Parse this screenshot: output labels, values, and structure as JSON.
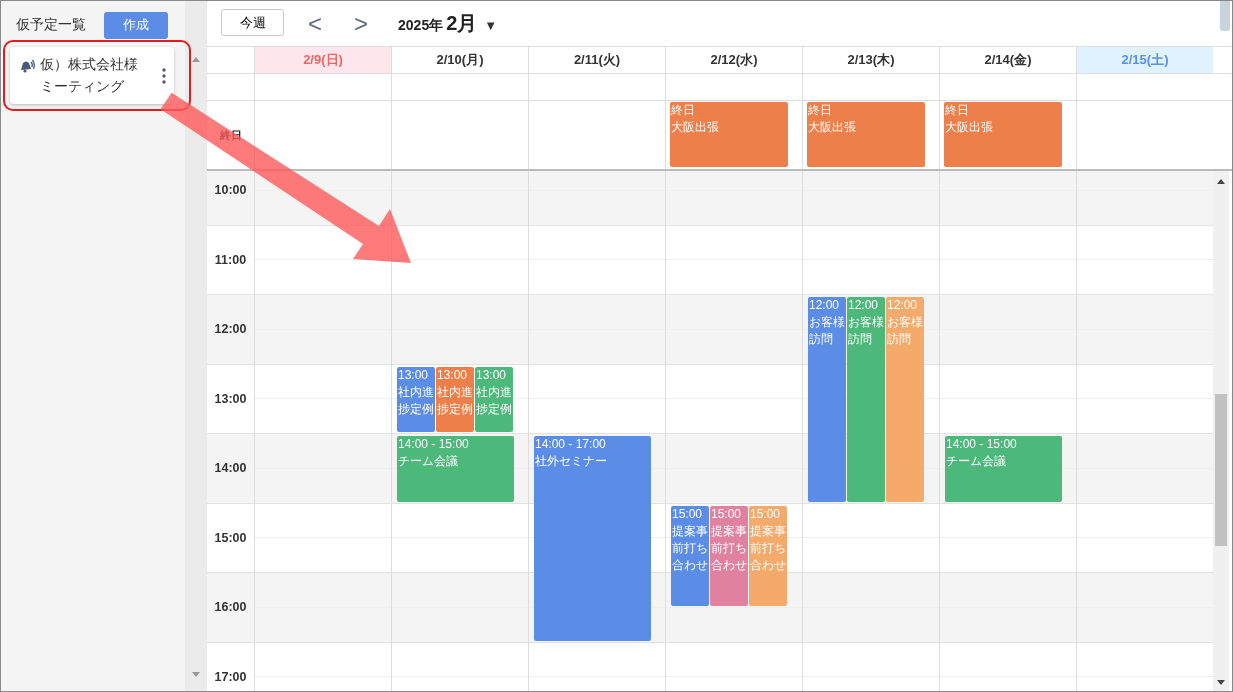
{
  "sidebar": {
    "title": "仮予定一覧",
    "create_button": "作成",
    "items": [
      {
        "title": "仮）株式会社様ミーティング"
      }
    ]
  },
  "toolbar": {
    "this_week": "今週",
    "prev": "<",
    "next": ">",
    "year": "2025年",
    "month": "2月",
    "dropdown": "▼"
  },
  "allday_label": "終日",
  "times": [
    "10:00",
    "11:00",
    "12:00",
    "13:00",
    "14:00",
    "15:00",
    "16:00",
    "17:00"
  ],
  "days": [
    {
      "date": "2/9(日)",
      "kind": "sunday"
    },
    {
      "date": "2/10(月)",
      "kind": "weekday",
      "slots": [
        {
          "kind": "hour",
          "events": [
            {
              "time": "13:00",
              "title": "社内進捗定例",
              "color": "#5b8de6"
            },
            {
              "time": "13:00",
              "title": "社内進捗定例",
              "color": "#ec7f4a"
            },
            {
              "time": "13:00",
              "title": "社内進捗定例",
              "color": "#4cb87a"
            }
          ]
        },
        {
          "kind": "hour",
          "events": [
            {
              "time": "14:00 - 15:00",
              "title": "チーム会議",
              "color": "#4cb87a"
            }
          ]
        }
      ]
    },
    {
      "date": "2/11(火)",
      "kind": "weekday",
      "slots": [
        {
          "kind": "threehour",
          "events": [
            {
              "time": "14:00 - 17:00",
              "title": "社外セミナー",
              "color": "#5b8de6"
            }
          ]
        }
      ]
    },
    {
      "date": "2/12(水)",
      "kind": "weekday",
      "allday": [
        {
          "time": "終日",
          "title": "大阪出張",
          "color": "#ec7f4a"
        }
      ],
      "slots": [
        {
          "kind": "ninety",
          "events": [
            {
              "time": "15:00",
              "title": "提案事前打ち合わせ",
              "color": "#5b8de6"
            },
            {
              "time": "15:00",
              "title": "提案事前打ち合わせ",
              "color": "#e0829f"
            },
            {
              "time": "15:00",
              "title": "提案事前打ち合わせ",
              "color": "#f4aa6b"
            }
          ]
        }
      ]
    },
    {
      "date": "2/13(木)",
      "kind": "weekday",
      "allday": [
        {
          "time": "終日",
          "title": "大阪出張",
          "color": "#ec7f4a"
        }
      ],
      "slots": [
        {
          "kind": "threehour",
          "events": [
            {
              "time": "12:00",
              "title": "お客様訪問",
              "color": "#5b8de6"
            },
            {
              "time": "12:00",
              "title": "お客様訪問",
              "color": "#4cb87a"
            },
            {
              "time": "12:00",
              "title": "お客様訪問",
              "color": "#f4aa6b"
            }
          ]
        }
      ]
    },
    {
      "date": "2/14(金)",
      "kind": "weekday",
      "allday": [
        {
          "time": "終日",
          "title": "大阪出張",
          "color": "#ec7f4a"
        }
      ],
      "slots": [
        {
          "kind": "hour",
          "events": [
            {
              "time": "14:00 - 15:00",
              "title": "チーム会議",
              "color": "#4cb87a"
            }
          ]
        }
      ]
    },
    {
      "date": "2/15(土)",
      "kind": "saturday"
    }
  ]
}
